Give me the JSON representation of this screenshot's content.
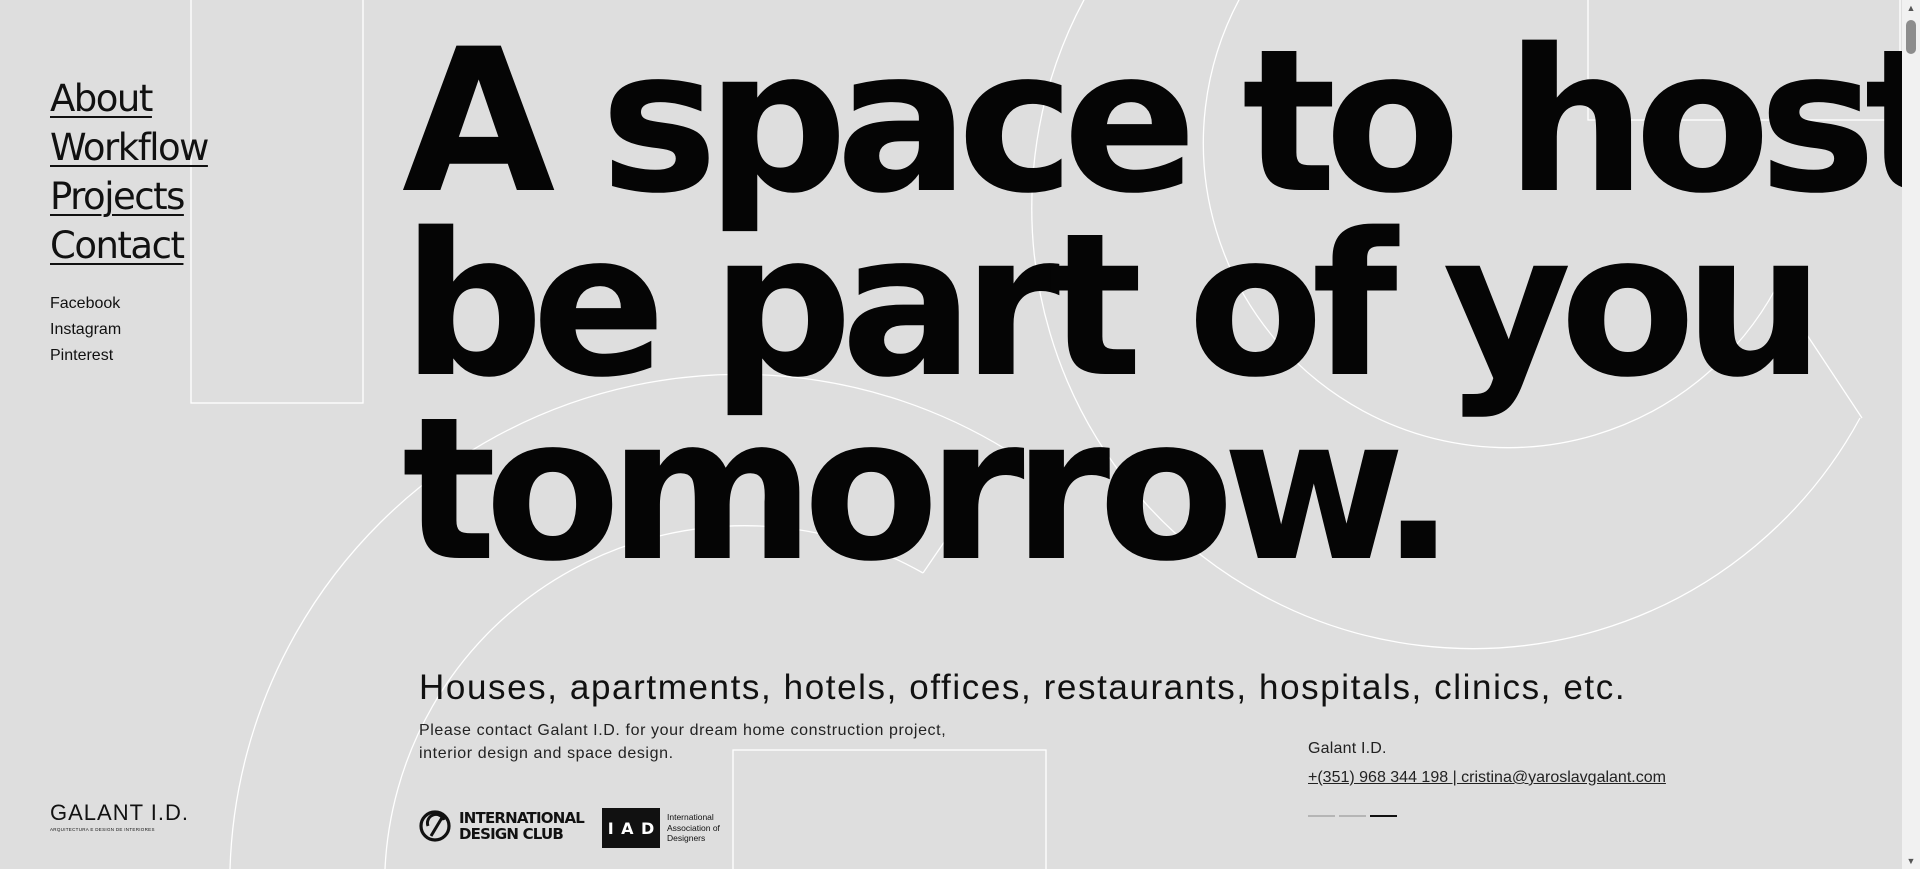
{
  "nav": {
    "items": [
      {
        "label": "About"
      },
      {
        "label": "Workflow"
      },
      {
        "label": "Projects"
      },
      {
        "label": "Contact"
      }
    ]
  },
  "social": {
    "items": [
      {
        "label": "Facebook"
      },
      {
        "label": "Instagram"
      },
      {
        "label": "Pinterest"
      }
    ]
  },
  "hero": {
    "lines": [
      "A space to host",
      "be part of you",
      "tomorrow."
    ]
  },
  "tagline": "Houses, apartments, hotels, offices, restaurants, hospitals, clinics, etc.",
  "intro": {
    "line1": "Please contact Galant I.D. for your dream home construction project,",
    "line2": "interior design and space design."
  },
  "brand": {
    "name": "GALANT I.D.",
    "subtitle": "ARQUITECTURA E DESIGN DE INTERIORES"
  },
  "badges": {
    "idc": {
      "line1": "INTERNATIONAL",
      "line2": "DESIGN CLUB"
    },
    "iad": {
      "letters": [
        "I",
        "A",
        "D"
      ],
      "line1": "International",
      "line2": "Association of",
      "line3": "Designers"
    }
  },
  "contact": {
    "company": "Galant I.D.",
    "details": "+(351) 968 344 198 | cristina@yaroslavgalant.com"
  },
  "slider": {
    "count": 3,
    "active_index": 2
  },
  "colors": {
    "background": "#dedede",
    "text": "#111111",
    "lines": "#ffffff"
  },
  "icons": {
    "scroll_up": "triangle-up-icon",
    "scroll_down": "triangle-down-icon"
  }
}
